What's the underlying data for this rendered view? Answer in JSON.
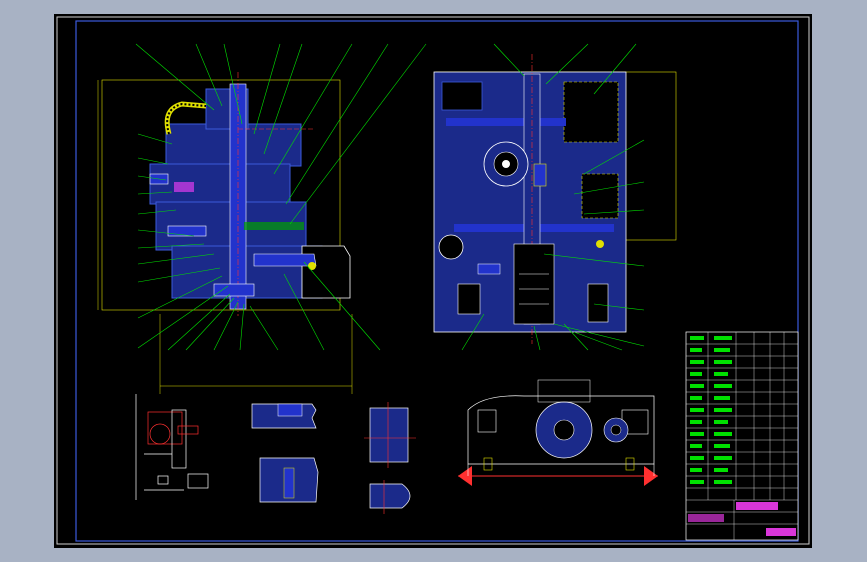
{
  "colors": {
    "background": "#000000",
    "frame": "#ffffff",
    "border_blue": "#3b5bdb",
    "hatch_blue": "#1b2a8a",
    "part_blue": "#2233cc",
    "leader_green": "#00e000",
    "center_red": "#ff3030",
    "dim_yellow": "#e0e000",
    "magenta": "#ff40ff",
    "outline_white": "#ffffff"
  },
  "title_block": {
    "part_name": "",
    "drawing_name": ""
  }
}
